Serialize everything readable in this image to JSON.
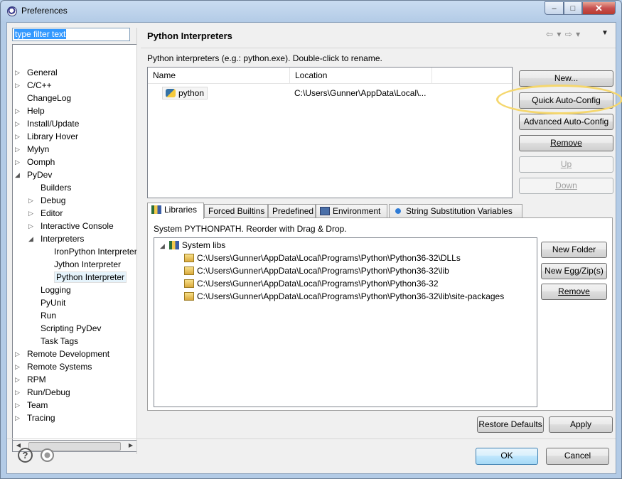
{
  "window": {
    "title": "Preferences",
    "close_glyph": "✕",
    "max_glyph": "□",
    "min_glyph": "‒"
  },
  "filter": {
    "value": "type filter text"
  },
  "tree": {
    "items": [
      {
        "label": "General",
        "twisty": "▷"
      },
      {
        "label": "C/C++",
        "twisty": "▷"
      },
      {
        "label": "ChangeLog",
        "twisty": ""
      },
      {
        "label": "Help",
        "twisty": "▷"
      },
      {
        "label": "Install/Update",
        "twisty": "▷"
      },
      {
        "label": "Library Hover",
        "twisty": "▷"
      },
      {
        "label": "Mylyn",
        "twisty": "▷"
      },
      {
        "label": "Oomph",
        "twisty": "▷"
      },
      {
        "label": "PyDev",
        "twisty": "◢"
      },
      {
        "label": "Builders",
        "twisty": ""
      },
      {
        "label": "Debug",
        "twisty": "▷"
      },
      {
        "label": "Editor",
        "twisty": "▷"
      },
      {
        "label": "Interactive Console",
        "twisty": "▷"
      },
      {
        "label": "Interpreters",
        "twisty": "◢"
      },
      {
        "label": "IronPython Interpreter",
        "twisty": ""
      },
      {
        "label": "Jython Interpreter",
        "twisty": ""
      },
      {
        "label": "Python Interpreter",
        "twisty": "",
        "selected": true
      },
      {
        "label": "Logging",
        "twisty": ""
      },
      {
        "label": "PyUnit",
        "twisty": ""
      },
      {
        "label": "Run",
        "twisty": ""
      },
      {
        "label": "Scripting PyDev",
        "twisty": ""
      },
      {
        "label": "Task Tags",
        "twisty": ""
      },
      {
        "label": "Remote Development",
        "twisty": "▷"
      },
      {
        "label": "Remote Systems",
        "twisty": "▷"
      },
      {
        "label": "RPM",
        "twisty": "▷"
      },
      {
        "label": "Run/Debug",
        "twisty": "▷"
      },
      {
        "label": "Team",
        "twisty": "▷"
      },
      {
        "label": "Tracing",
        "twisty": "▷"
      }
    ]
  },
  "page": {
    "title": "Python Interpreters",
    "nav_back": "⇦ ▾",
    "nav_forward": "⇨ ▾",
    "nav_menu": "▼",
    "description": "Python interpreters (e.g.: python.exe).   Double-click to rename.",
    "columns": {
      "name": "Name",
      "location": "Location"
    },
    "interpreters": [
      {
        "name": "python",
        "location": "C:\\Users\\Gunner\\AppData\\Local\\..."
      }
    ]
  },
  "buttons": {
    "new": "New...",
    "quick_auto_config": "Quick Auto-Config",
    "advanced_auto_config": "Advanced Auto-Config",
    "remove": "Remove",
    "up": "Up",
    "down": "Down",
    "new_folder": "New Folder",
    "new_egg": "New Egg/Zip(s)",
    "remove_lib": "Remove",
    "restore_defaults": "Restore Defaults",
    "apply": "Apply",
    "ok": "OK",
    "cancel": "Cancel"
  },
  "tabs": [
    {
      "label": "Libraries",
      "active": true
    },
    {
      "label": "Forced Builtins"
    },
    {
      "label": "Predefined"
    },
    {
      "label": "Environment"
    },
    {
      "label": "String Substitution Variables"
    }
  ],
  "libraries": {
    "hint": "System PYTHONPATH.   Reorder with Drag & Drop.",
    "root": "System libs",
    "paths": [
      "C:\\Users\\Gunner\\AppData\\Local\\Programs\\Python\\Python36-32\\DLLs",
      "C:\\Users\\Gunner\\AppData\\Local\\Programs\\Python\\Python36-32\\lib",
      "C:\\Users\\Gunner\\AppData\\Local\\Programs\\Python\\Python36-32",
      "C:\\Users\\Gunner\\AppData\\Local\\Programs\\Python\\Python36-32\\lib\\site-packages"
    ]
  },
  "footer": {
    "help_glyph": "?"
  },
  "colors": {
    "highlight_ring": "#f5d76e",
    "selection": "#3399ff",
    "title_bar": "#b3cbe6"
  },
  "icons": [
    "eclipse-logo-icon",
    "python-icon",
    "library-icon",
    "folder-icon",
    "environment-icon",
    "help-icon",
    "record-icon"
  ]
}
